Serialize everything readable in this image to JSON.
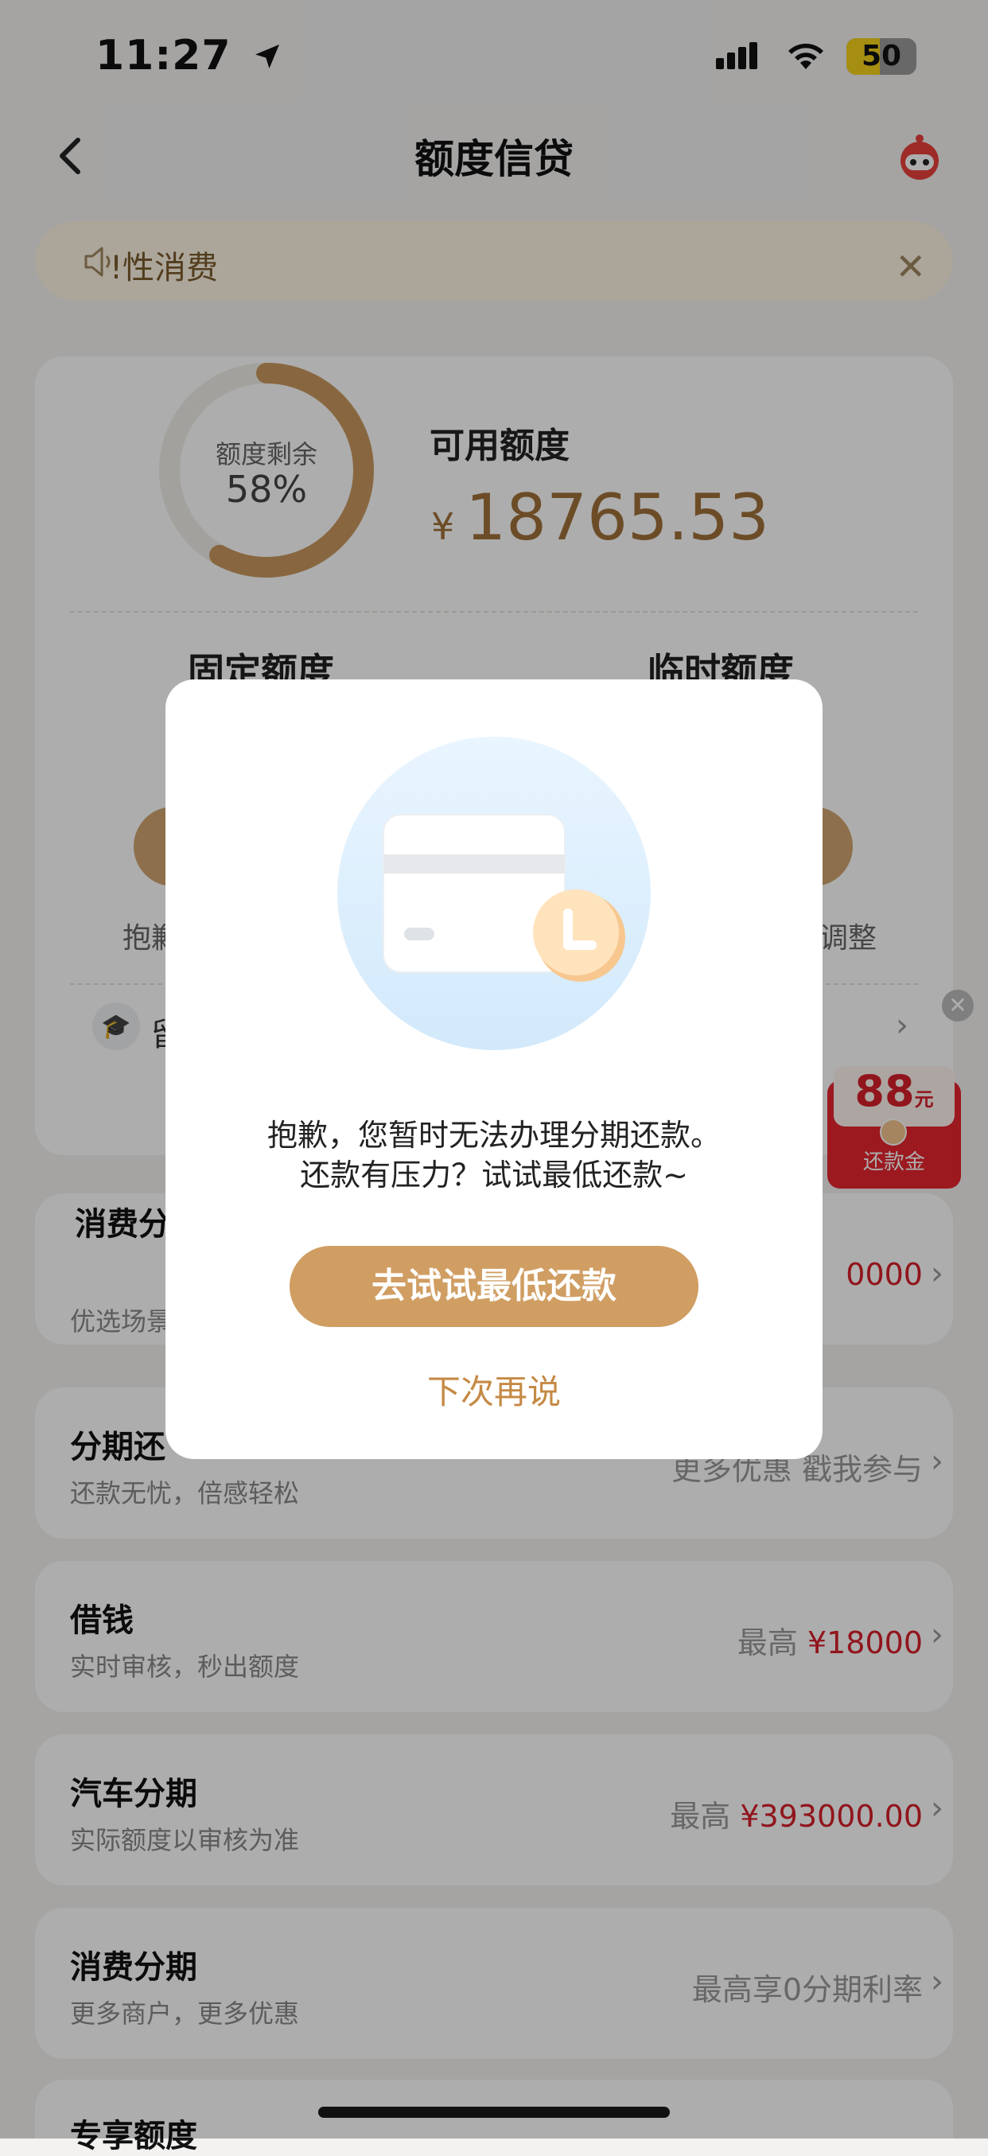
{
  "status_bar": {
    "time": "11:27",
    "battery_percent": "50"
  },
  "header": {
    "title": "额度信贷"
  },
  "notice": {
    "text": "!性消费"
  },
  "quota_card": {
    "ring_label": "额度剩余",
    "ring_percent": "58%",
    "ring_fraction": 0.58,
    "available_label": "可用额度",
    "currency_symbol": "¥",
    "available_amount": "18765.53",
    "fixed_label": "固定额度",
    "temp_label": "临时额度",
    "sorry_partial": "抱歉",
    "adjust_partial": "调整",
    "promo_partial": "留"
  },
  "red_packet": {
    "amount": "88",
    "unit": "元",
    "label": "还款金"
  },
  "rows": [
    {
      "title": "消费分",
      "sub": "优选场景",
      "right_prefix": "",
      "right_value": "0000",
      "right_plain": ""
    },
    {
      "title": "分期还",
      "sub": "还款无忧，倍感轻松",
      "right_prefix": "",
      "right_value": "",
      "right_plain": "更多优惠 戳我参与"
    },
    {
      "title": "借钱",
      "sub": "实时审核，秒出额度",
      "right_prefix": "最高",
      "right_value": "¥18000",
      "right_plain": ""
    },
    {
      "title": "汽车分期",
      "sub": "实际额度以审核为准",
      "right_prefix": "最高",
      "right_value": "¥393000.00",
      "right_plain": ""
    },
    {
      "title": "消费分期",
      "sub": "更多商户，更多优惠",
      "right_prefix": "",
      "right_value": "",
      "right_plain": "最高享0分期利率"
    },
    {
      "title": "专享额度"
    }
  ],
  "dialog": {
    "line1": "抱歉，您暂时无法办理分期还款。",
    "line2": "还款有压力？试试最低还款~",
    "primary_button": "去试试最低还款",
    "secondary_button": "下次再说"
  },
  "colors": {
    "accent": "#d09e63",
    "accent_text": "#a0703a",
    "red": "#d6202a"
  },
  "icons": {
    "back": "back-arrow-icon",
    "notice": "speaker-icon",
    "close": "close-icon",
    "service": "robot-service-icon",
    "chevron": "chevron-right-icon",
    "graduation": "graduation-cap-icon"
  }
}
